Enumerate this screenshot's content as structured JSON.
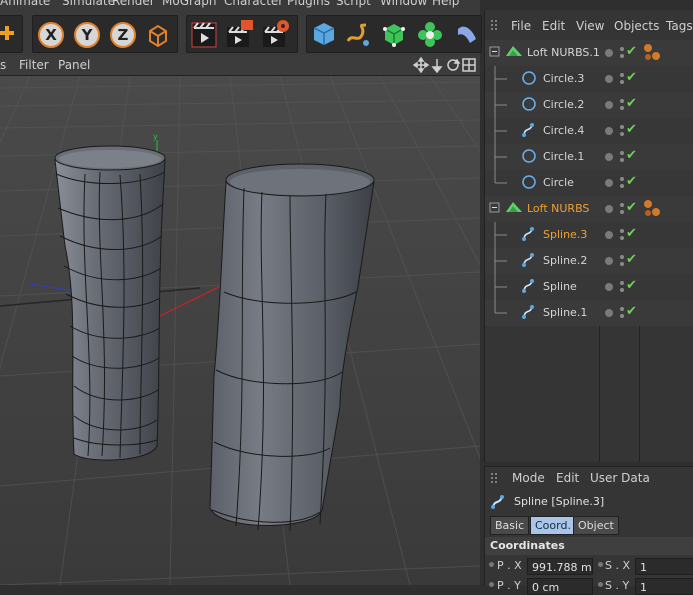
{
  "menubar": [
    "Animate",
    "Simulate",
    "Render",
    "MoGraph",
    "Character",
    "Plugins",
    "Script",
    "Window",
    "Help"
  ],
  "axis_buttons": [
    "X",
    "Y",
    "Z"
  ],
  "viewport_menu": [
    "s",
    "Filter",
    "Panel"
  ],
  "object_manager": {
    "menu": [
      "File",
      "Edit",
      "View",
      "Objects",
      "Tags"
    ],
    "rows": [
      {
        "label": "Loft NURBS.1",
        "type": "loft",
        "indent": 0,
        "selected": false,
        "tag": true
      },
      {
        "label": "Circle.3",
        "type": "circle",
        "indent": 1,
        "selected": false,
        "tag": false
      },
      {
        "label": "Circle.2",
        "type": "circle",
        "indent": 1,
        "selected": false,
        "tag": false
      },
      {
        "label": "Circle.4",
        "type": "spline",
        "indent": 1,
        "selected": false,
        "tag": false
      },
      {
        "label": "Circle.1",
        "type": "circle",
        "indent": 1,
        "selected": false,
        "tag": false
      },
      {
        "label": "Circle",
        "type": "circle",
        "indent": 1,
        "selected": false,
        "tag": false
      },
      {
        "label": "Loft NURBS",
        "type": "loft",
        "indent": 0,
        "selected": true,
        "tag": true
      },
      {
        "label": "Spline.3",
        "type": "spline",
        "indent": 1,
        "selected": true,
        "tag": false
      },
      {
        "label": "Spline.2",
        "type": "spline",
        "indent": 1,
        "selected": false,
        "tag": false
      },
      {
        "label": "Spline",
        "type": "spline",
        "indent": 1,
        "selected": false,
        "tag": false
      },
      {
        "label": "Spline.1",
        "type": "spline",
        "indent": 1,
        "selected": false,
        "tag": false
      }
    ]
  },
  "attribute_manager": {
    "menu": [
      "Mode",
      "Edit",
      "User Data"
    ],
    "object_title": "Spline [Spline.3]",
    "tabs": [
      "Basic",
      "Coord.",
      "Object"
    ],
    "active_tab": "Coord.",
    "section": "Coordinates",
    "pos_x_label": "P . X",
    "pos_x_value": "991.788 m",
    "scale_x_label": "S . X",
    "scale_x_value": "1",
    "pos_y_label": "P . Y",
    "pos_y_value": "0 cm",
    "scale_y_label": "S . Y",
    "scale_y_value": "1"
  },
  "colors": {
    "accent": "#e2802a",
    "selected_text": "#f0a030",
    "check": "#6fd05a",
    "active_tab": "#a9c6e8"
  }
}
